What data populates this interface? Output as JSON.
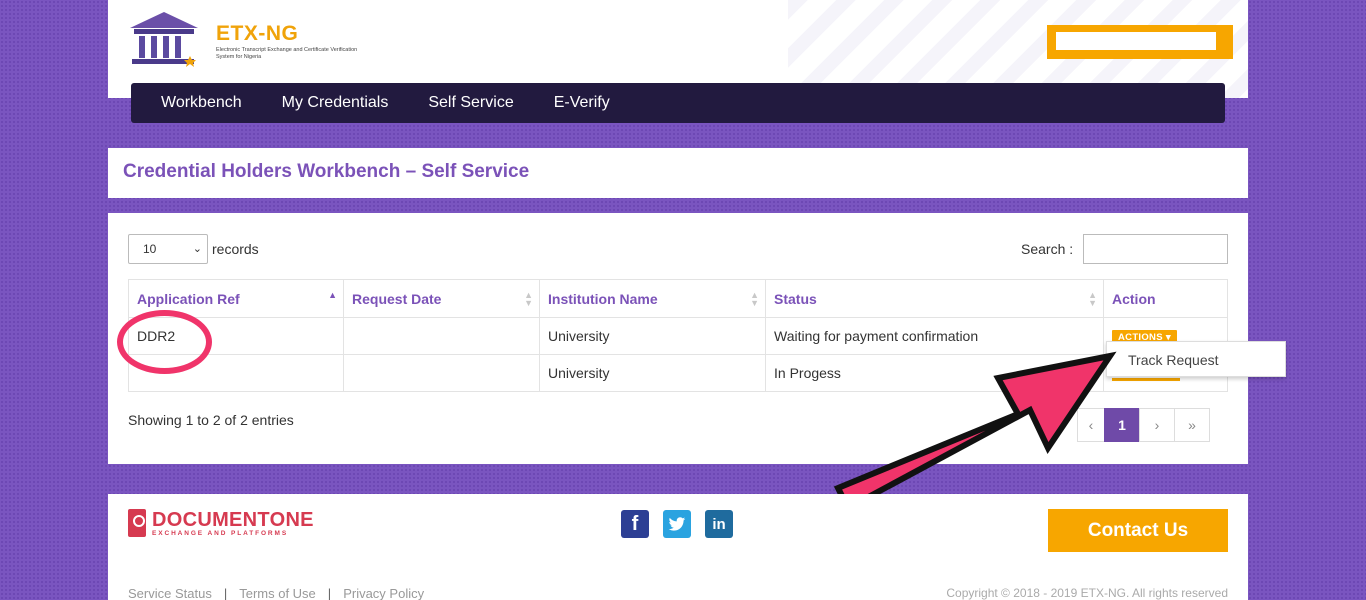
{
  "header": {
    "logo_title": "ETX-NG",
    "logo_subtitle": "Electronic Transcript Exchange and Certificate Verification System for Nigeria"
  },
  "nav": {
    "items": [
      "Workbench",
      "My Credentials",
      "Self Service",
      "E-Verify"
    ]
  },
  "page": {
    "title": "Credential Holders Workbench – Self Service"
  },
  "table_controls": {
    "length_value": "10",
    "records_label": "records",
    "search_label": "Search :",
    "search_value": ""
  },
  "table": {
    "columns": [
      "Application Ref",
      "Request Date",
      "Institution Name",
      "Status",
      "Action"
    ],
    "rows": [
      {
        "ref": "DDR2",
        "date": "",
        "institution": "University",
        "status": "Waiting for payment confirmation",
        "action": "ACTIONS"
      },
      {
        "ref": "",
        "date": "",
        "institution": "University",
        "status": "In Progess",
        "action": ""
      }
    ]
  },
  "dropdown": {
    "item": "Track Request"
  },
  "info_text": "Showing 1 to 2 of 2 entries",
  "pagination": {
    "prev": "‹",
    "current": "1",
    "next": "›",
    "last": "»"
  },
  "footer": {
    "brand_name": "DOCUMENTONE",
    "brand_sub": "EXCHANGE AND PLATFORMS",
    "social_icons": [
      "facebook-icon",
      "twitter-icon",
      "linkedin-icon"
    ],
    "contact_label": "Contact Us",
    "links": [
      "Service Status",
      "Terms of Use",
      "Privacy Policy"
    ],
    "copyright": "Copyright © 2018 - 2019 ETX-NG. All rights reserved"
  },
  "colors": {
    "accent_purple": "#7b52b8",
    "orange": "#f7a600",
    "nav_bg": "#221a3f",
    "highlight_pink": "#f0346a"
  }
}
